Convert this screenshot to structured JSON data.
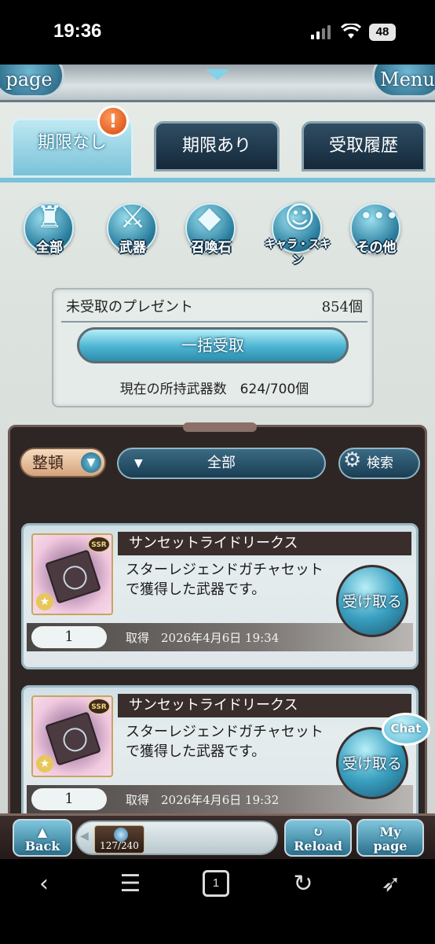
{
  "status": {
    "time": "19:36",
    "battery": "48"
  },
  "topframe": {
    "left_button": "page",
    "right_button": "Menu"
  },
  "tabs": [
    {
      "label": "期限なし",
      "active": true
    },
    {
      "label": "期限あり",
      "active": false
    },
    {
      "label": "受取履歴",
      "active": false
    }
  ],
  "tab_alert": "!",
  "categories": [
    {
      "label": "全部",
      "icon": "sword-figure-icon"
    },
    {
      "label": "武器",
      "icon": "sword-icon"
    },
    {
      "label": "召喚石",
      "icon": "crystal-icon"
    },
    {
      "label": "キャラ・スキン",
      "icon": "character-icon"
    },
    {
      "label": "その他",
      "icon": "more-dots-icon"
    }
  ],
  "summary": {
    "label": "未受取のプレゼント",
    "count": "854個",
    "bulk_button": "一括受取",
    "owned": "現在の所持武器数　624/700個"
  },
  "list_controls": {
    "sort": "整頓",
    "filter": "全部",
    "search": "検索"
  },
  "items": [
    {
      "name": "サンセットライドリークス",
      "rarity": "SSR",
      "description": "スターレジェンドガチャセットで獲得した武器です。",
      "quantity": "1",
      "acquired": "取得　2026年4月6日 19:34",
      "receive": "受け取る"
    },
    {
      "name": "サンセットライドリークス",
      "rarity": "SSR",
      "description": "スターレジェンドガチャセットで獲得した武器です。",
      "quantity": "1",
      "acquired": "取得　2026年4月6日 19:32",
      "receive": "受け取る"
    }
  ],
  "chat": "Chat",
  "gamenav": {
    "back": "Back",
    "ap": "127/240",
    "reload": "Reload",
    "mypage_top": "My",
    "mypage_bottom": "page"
  },
  "browser": {
    "tabs_count": "1"
  },
  "colors": {
    "accent": "#4cb4d2",
    "panel_dark": "#2e2624",
    "alert": "#d4470c"
  }
}
